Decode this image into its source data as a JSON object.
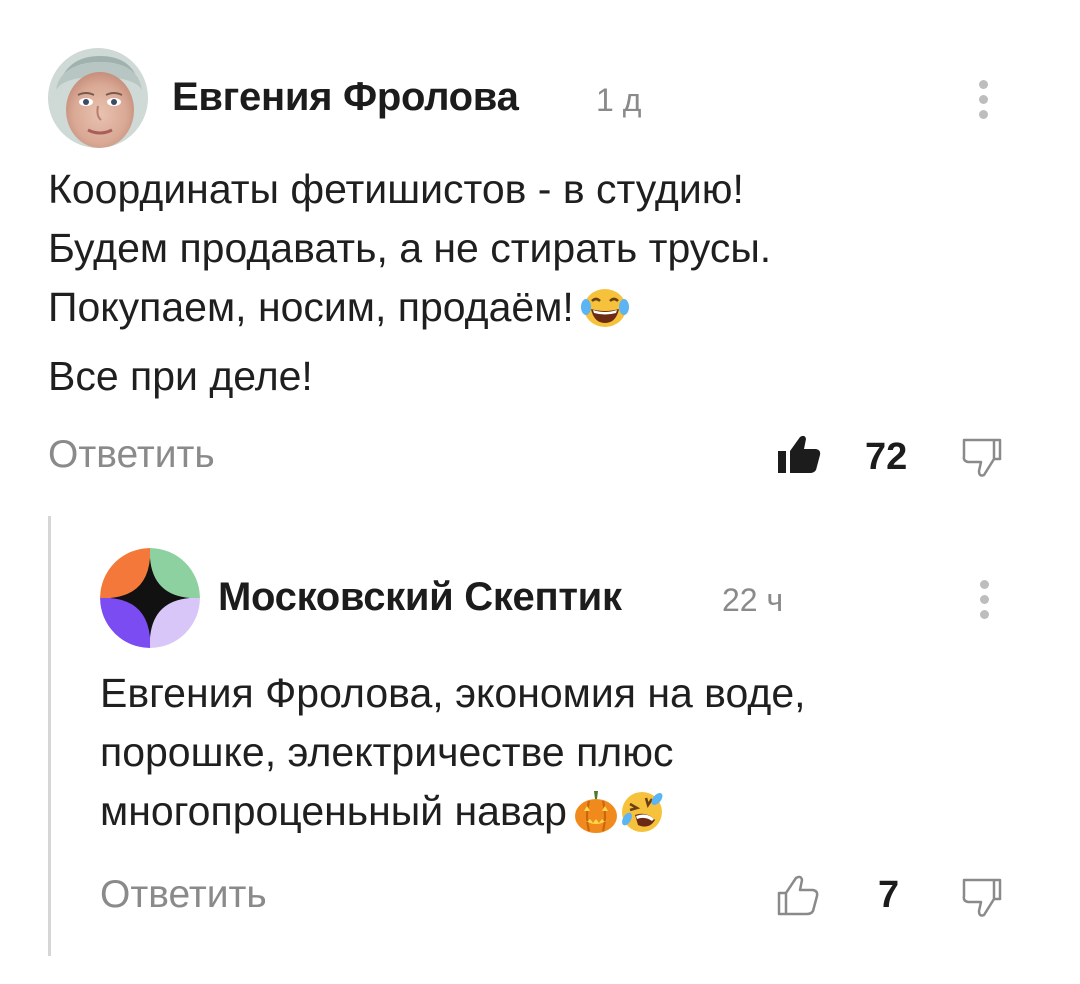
{
  "comments": [
    {
      "author": "Евгения Фролова",
      "time": "1 д",
      "avatar": "user-photo-avatar",
      "lines": [
        "Координаты фетишистов - в студию!",
        "Будем продавать, а не стирать трусы.",
        "Покупаем, носим, продаём!",
        "Все при деле!"
      ],
      "emoji": "face-with-tears-of-joy",
      "reply_label": "Ответить",
      "likes": "72",
      "liked": true
    },
    {
      "author": "Московский Скептик",
      "time": "22 ч",
      "avatar": "channel-logo-avatar",
      "lines": [
        "Евгения Фролова, экономия на воде,",
        "порошке, электричестве плюс",
        "многопроценьный навар"
      ],
      "emoji": [
        "jack-o-lantern",
        "rolling-on-floor-laughing"
      ],
      "reply_label": "Ответить",
      "likes": "7",
      "liked": false
    }
  ],
  "colors": {
    "text": "#1f1f1f",
    "muted": "#8a8a8a",
    "thread_line": "#d6d6d6",
    "logo_orange": "#f4783a",
    "logo_green": "#8ed1a0",
    "logo_purple": "#7b4cf2",
    "logo_lavender": "#d7c6f7"
  }
}
